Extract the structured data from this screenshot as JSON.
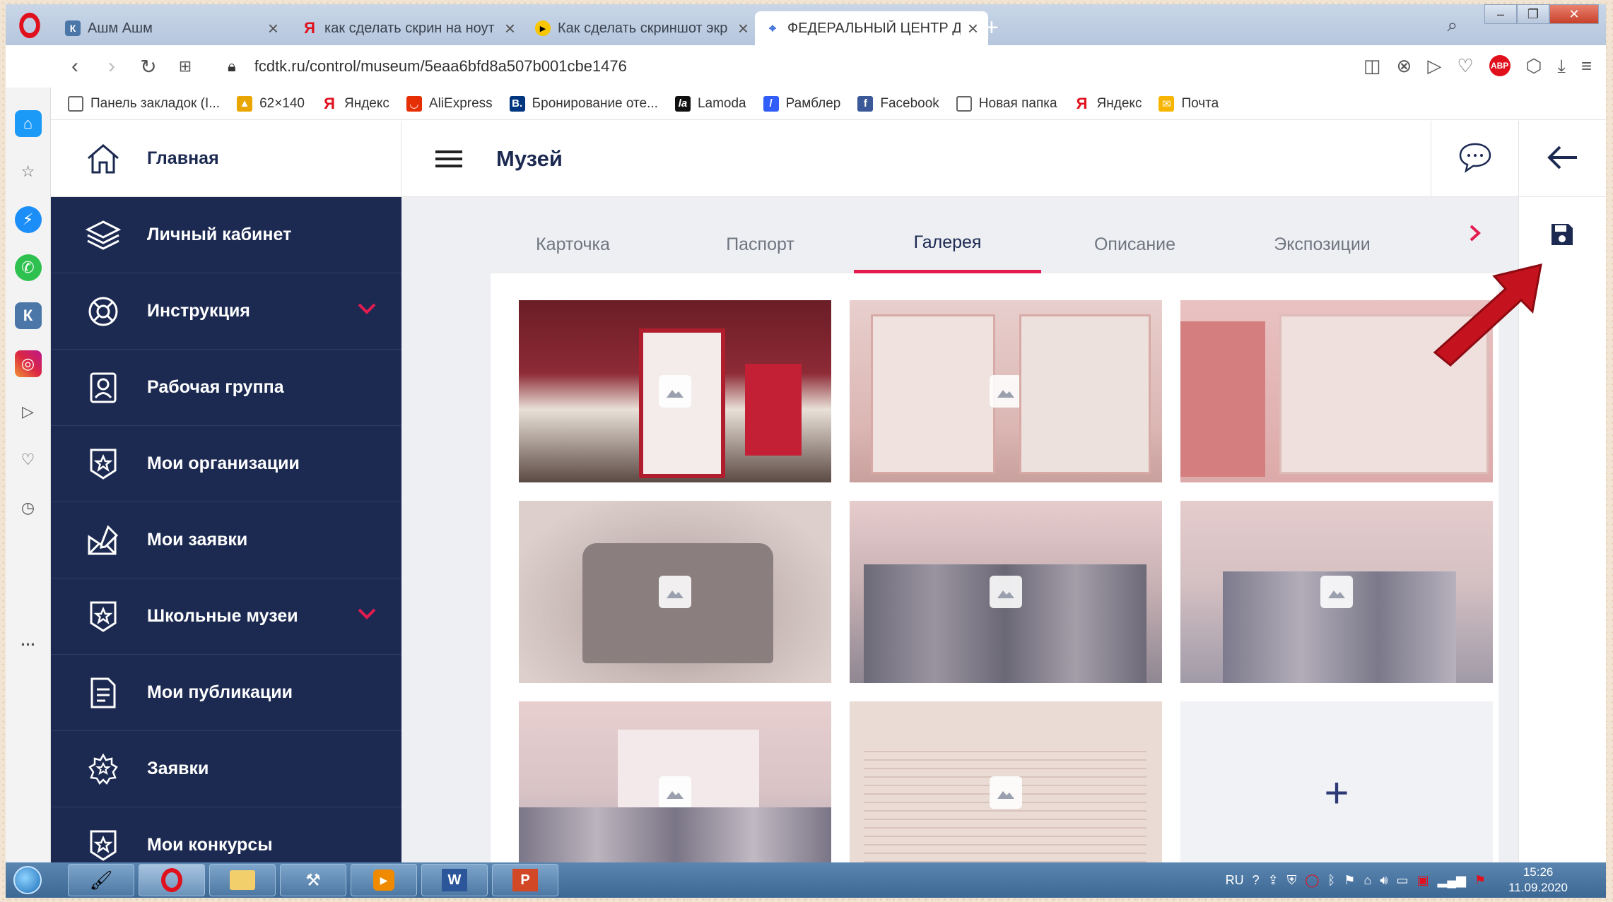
{
  "browser": {
    "tabs": [
      {
        "title": "Ашм Ашм",
        "icon": "vk-icon"
      },
      {
        "title": "как сделать скрин на ноут",
        "icon": "yandex-icon"
      },
      {
        "title": "Как сделать скриншот экр",
        "icon": "play-icon"
      },
      {
        "title": "ФЕДЕРАЛЬНЫЙ ЦЕНТР ДЕ",
        "icon": "site-icon",
        "active": true
      }
    ],
    "url": "fcdtk.ru/control/museum/5eaa6bfd8a507b001cbe1476",
    "bookmarks": [
      {
        "label": "Панель закладок (I...",
        "icon": "folder-icon"
      },
      {
        "label": "62×140",
        "icon": "image-icon"
      },
      {
        "label": "Яндекс",
        "icon": "yandex-icon"
      },
      {
        "label": "AliExpress",
        "icon": "aliexpress-icon"
      },
      {
        "label": "Бронирование оте...",
        "icon": "booking-icon"
      },
      {
        "label": "Lamoda",
        "icon": "lamoda-icon"
      },
      {
        "label": "Рамблер",
        "icon": "rambler-icon"
      },
      {
        "label": "Facebook",
        "icon": "facebook-icon"
      },
      {
        "label": "Новая папка",
        "icon": "folder-icon"
      },
      {
        "label": "Яндекс",
        "icon": "yandex-icon"
      },
      {
        "label": "Почта",
        "icon": "mail-icon"
      }
    ],
    "abp_badge": "1"
  },
  "app": {
    "home_label": "Главная",
    "page_title": "Музей",
    "nav": [
      {
        "label": "Личный кабинет",
        "icon": "layers-icon",
        "chevron": false
      },
      {
        "label": "Инструкция",
        "icon": "lifebuoy-icon",
        "chevron": true
      },
      {
        "label": "Рабочая группа",
        "icon": "user-badge-icon",
        "chevron": false
      },
      {
        "label": "Мои организации",
        "icon": "star-shield-icon",
        "chevron": false
      },
      {
        "label": "Мои заявки",
        "icon": "envelope-edit-icon",
        "chevron": false
      },
      {
        "label": "Школьные музеи",
        "icon": "star-shield-icon",
        "chevron": true
      },
      {
        "label": "Мои публикации",
        "icon": "document-icon",
        "chevron": false
      },
      {
        "label": "Заявки",
        "icon": "badge-star-icon",
        "chevron": false
      },
      {
        "label": "Мои конкурсы",
        "icon": "star-shield-icon",
        "chevron": false
      }
    ],
    "tabs": [
      "Карточка",
      "Паспорт",
      "Галерея",
      "Описание",
      "Экспозиции"
    ],
    "active_tab": "Галерея",
    "gallery_add_label": "+"
  },
  "taskbar": {
    "lang": "RU",
    "time": "15:26",
    "date": "11.09.2020"
  },
  "colors": {
    "nav_bg": "#1c2a52",
    "accent": "#e31b4f",
    "arrow": "#c4121e"
  }
}
